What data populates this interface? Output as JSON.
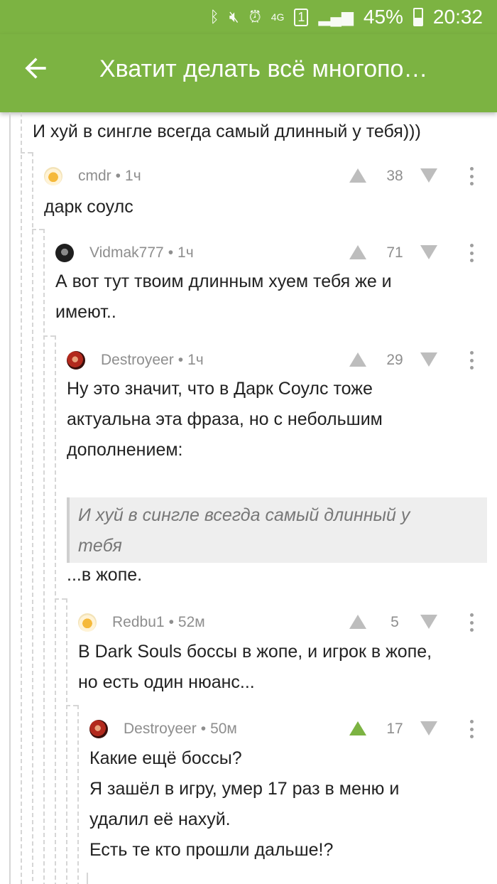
{
  "status_bar": {
    "icons": [
      "bluetooth-icon",
      "mute-icon",
      "alarm-icon",
      "4g-icon",
      "sim-1-icon",
      "signal-icon",
      "battery-icon"
    ],
    "battery": "45%",
    "time": "20:32"
  },
  "app_bar": {
    "title": "Хватит делать всё многопо…"
  },
  "top_text": "И хуй в сингле всегда самый длинный у тебя)))",
  "comments": [
    {
      "user": "cmdr",
      "time": "1ч",
      "score": "38",
      "avatar_icon": "beer-avatar",
      "lines": [
        "дарк соулс"
      ]
    },
    {
      "user": "Vidmak777",
      "time": "1ч",
      "score": "71",
      "avatar_icon": "dark-avatar",
      "lines": [
        "А вот тут твоим длинным хуем тебя же и",
        "имеют.."
      ]
    },
    {
      "user": "Destroyeer",
      "time": "1ч",
      "score": "29",
      "avatar_icon": "red-avatar",
      "lines": [
        "Ну это значит, что в Дарк Соулс тоже",
        "актуальна эта фраза, но с небольшим",
        "дополнением:"
      ],
      "quote": [
        "И хуй в сингле всегда самый длинный у",
        "тебя"
      ],
      "after": "...в жопе."
    },
    {
      "user": "Redbu1",
      "time": "52м",
      "score": "5",
      "avatar_icon": "beer-avatar",
      "lines": [
        "В Dark Souls боссы в жопе, и игрок в жопе,",
        "но есть один нюанс..."
      ]
    },
    {
      "user": "Destroyeer",
      "time": "50м",
      "score": "17",
      "avatar_icon": "red-avatar",
      "upvoted": true,
      "lines": [
        "Какие ещё боссы?",
        "Я зашёл в игру, умер 17 раз в меню и",
        "удалил её нахуй.",
        "Есть те кто прошли дальше!?"
      ]
    }
  ],
  "colors": {
    "accent": "#7cb342",
    "meta": "#8e8e8e"
  }
}
